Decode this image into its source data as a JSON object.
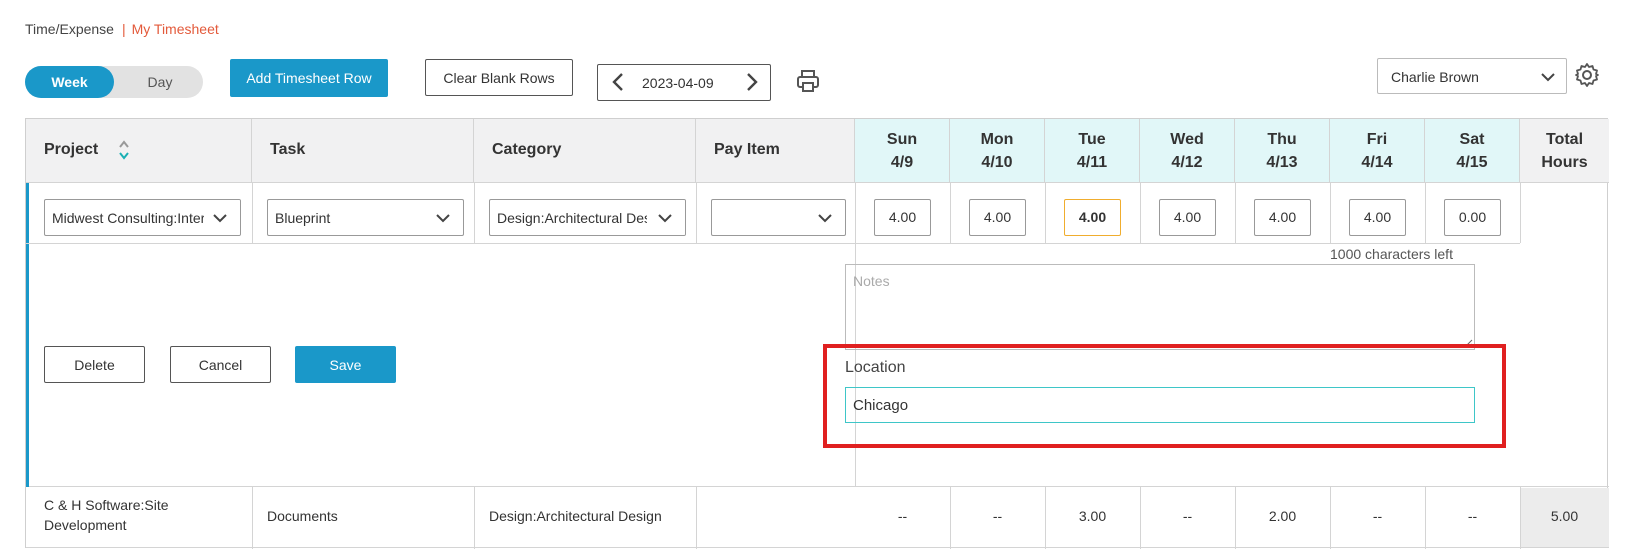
{
  "breadcrumb": {
    "parent": "Time/Expense",
    "separator": "|",
    "current": "My Timesheet"
  },
  "toolbar": {
    "view_week": "Week",
    "view_day": "Day",
    "add_row": "Add Timesheet Row",
    "clear_blank": "Clear Blank Rows",
    "week_start": "2023-04-09",
    "employee": "Charlie Brown"
  },
  "columns": {
    "project": "Project",
    "task": "Task",
    "category": "Category",
    "pay_item": "Pay Item",
    "days": [
      {
        "name": "Sun",
        "date": "4/9"
      },
      {
        "name": "Mon",
        "date": "4/10"
      },
      {
        "name": "Tue",
        "date": "4/11"
      },
      {
        "name": "Wed",
        "date": "4/12"
      },
      {
        "name": "Thu",
        "date": "4/13"
      },
      {
        "name": "Fri",
        "date": "4/14"
      },
      {
        "name": "Sat",
        "date": "4/15"
      }
    ],
    "total_line1": "Total",
    "total_line2": "Hours"
  },
  "edit_row": {
    "project": "Midwest Consulting:Internal",
    "task": "Blueprint",
    "category": "Design:Architectural Design",
    "pay_item": "",
    "hours": [
      "4.00",
      "4.00",
      "4.00",
      "4.00",
      "4.00",
      "4.00",
      "0.00"
    ],
    "chars_left": "1000 characters left",
    "notes_placeholder": "Notes",
    "location_label": "Location",
    "location_value": "Chicago",
    "delete": "Delete",
    "cancel": "Cancel",
    "save": "Save"
  },
  "rows": [
    {
      "project": "C & H Software:Site Development",
      "task": "Documents",
      "category": "Design:Architectural Design",
      "pay_item": "",
      "hours": [
        "--",
        "--",
        "3.00",
        "--",
        "2.00",
        "--",
        "--"
      ],
      "total": "5.00"
    }
  ],
  "colors": {
    "accent": "#1a98c9",
    "breadcrumb_active": "#e35a3b",
    "day_header": "#e1f7f8",
    "highlight": "#e02020",
    "active_cell": "#f0ad2e"
  }
}
